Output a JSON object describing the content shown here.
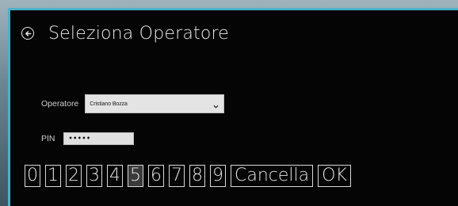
{
  "header": {
    "back_icon": "back-arrow-circle-icon",
    "title": "Seleziona Operatore"
  },
  "form": {
    "operator_label": "Operatore",
    "operator_value": "Cristiano Bozza",
    "operator_dropdown_icon": "chevron-down-icon",
    "pin_label": "PIN",
    "pin_value": "•••••"
  },
  "keypad": {
    "keys": [
      "0",
      "1",
      "2",
      "3",
      "4",
      "5",
      "6",
      "7",
      "8",
      "9"
    ],
    "selected_key": "5",
    "clear_label": "Cancella",
    "ok_label": "OK"
  },
  "colors": {
    "window_border": "#4cb0c8",
    "window_background": "#050505",
    "text": "#eaeaea"
  }
}
